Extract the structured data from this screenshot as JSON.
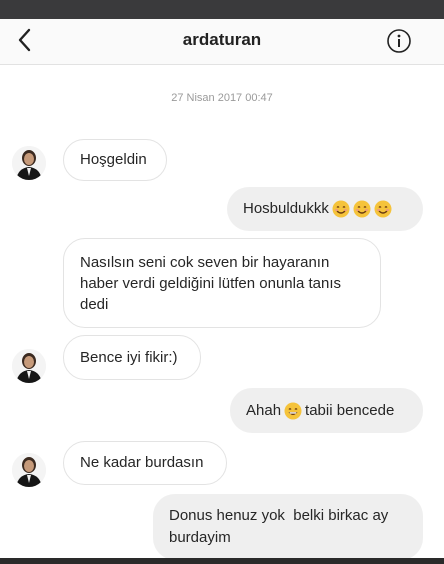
{
  "header": {
    "title": "ardaturan"
  },
  "date_stamp": "27 Nisan 2017 00:47",
  "messages": [
    {
      "text": "Hoşgeldin"
    },
    {
      "text": "Hosbuldukkk"
    },
    {
      "text": "Nasılsın seni cok seven bir hayaranın haber verdi geldiğini lütfen onunla tanıs dedi"
    },
    {
      "text": "Bence iyi fikir:)"
    },
    {
      "text_before": "Ahah",
      "text_after": "tabii bencede"
    },
    {
      "text": "Ne kadar burdasın"
    },
    {
      "text": "Donus henuz yok  belki birkac ay burdayim"
    }
  ],
  "colors": {
    "emoji": "#f5c33b"
  }
}
